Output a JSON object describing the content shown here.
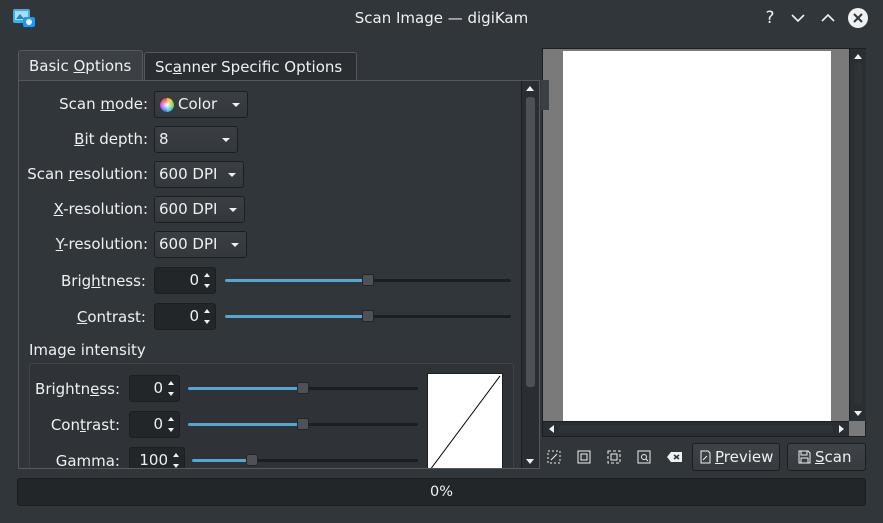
{
  "window": {
    "title": "Scan Image — digiKam",
    "help_label": "?"
  },
  "icons": {
    "app": "digikam-scan-icon",
    "minimize": "chevron-down-icon",
    "maximize": "chevron-up-icon",
    "close": "close-icon"
  },
  "tabs": [
    {
      "pre": "Basic ",
      "key": "O",
      "post": "ptions"
    },
    {
      "pre": "Sc",
      "key": "a",
      "post": "nner Specific Options"
    }
  ],
  "options": {
    "scan_mode": {
      "pre": "Scan ",
      "key": "m",
      "post": "ode:",
      "value": "Color"
    },
    "bit_depth": {
      "pre": "",
      "key": "B",
      "post": "it depth:",
      "value": "8"
    },
    "scan_resolution": {
      "pre": "Scan ",
      "key": "r",
      "post": "esolution:",
      "value": "600 DPI"
    },
    "x_resolution": {
      "pre": "",
      "key": "X",
      "post": "-resolution:",
      "value": "600 DPI"
    },
    "y_resolution": {
      "pre": "",
      "key": "Y",
      "post": "-resolution:",
      "value": "600 DPI"
    },
    "brightness": {
      "pre": "Brig",
      "key": "h",
      "post": "tness:",
      "value": "0",
      "level": 0.5
    },
    "contrast": {
      "pre": "",
      "key": "C",
      "post": "ontrast:",
      "value": "0",
      "level": 0.5
    }
  },
  "intensity": {
    "title": "Image intensity",
    "brightness": {
      "pre": "Brightn",
      "key": "e",
      "post": "ss:",
      "value": "0",
      "level": 0.5
    },
    "contrast": {
      "pre": "Con",
      "key": "t",
      "post": "rast:",
      "value": "0",
      "level": 0.5
    },
    "gamma": {
      "label": "Gamma:",
      "value": "100",
      "level": 0.25
    }
  },
  "toolbar": {
    "preview": {
      "key": "P",
      "post": "review"
    },
    "scan": {
      "key": "S",
      "post": "can"
    }
  },
  "progress": {
    "text": "0%",
    "value": 0
  }
}
